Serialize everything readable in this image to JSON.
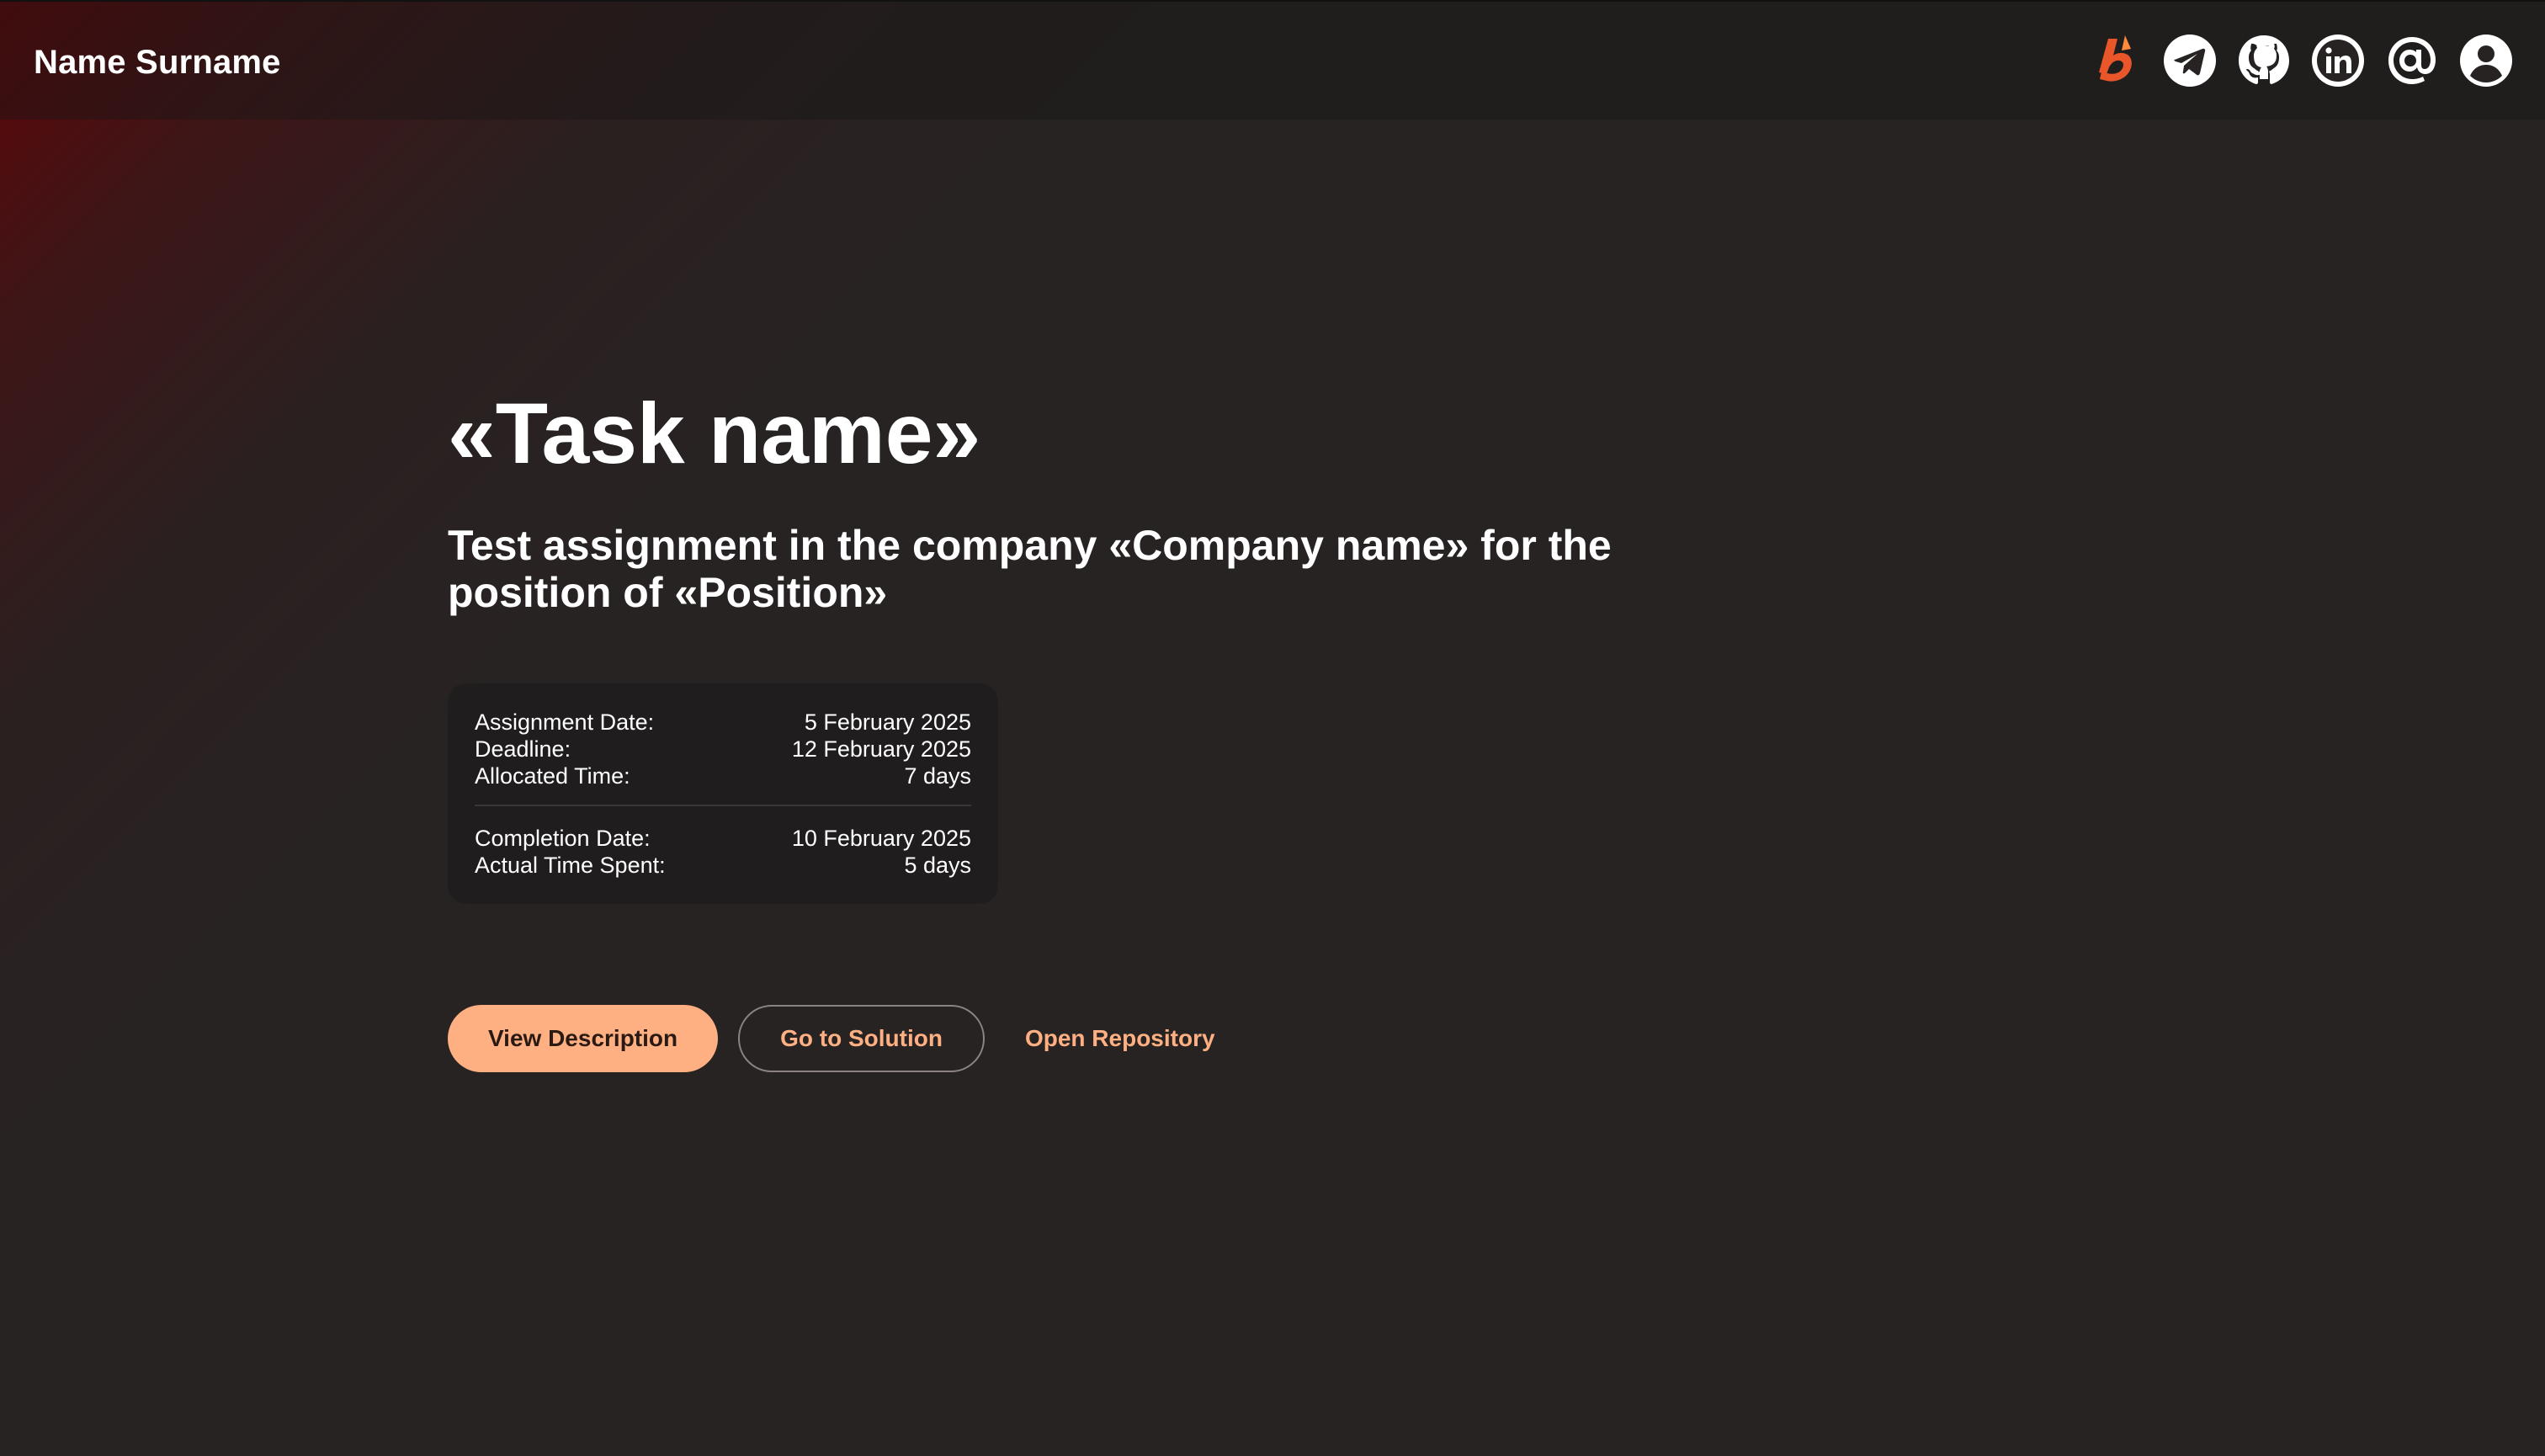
{
  "header": {
    "name": "Name Surname",
    "icons": [
      "behance-icon",
      "telegram-icon",
      "github-icon",
      "linkedin-icon",
      "email-icon",
      "profile-icon"
    ],
    "accent_icon_color": "#e8562a"
  },
  "task": {
    "title": "«Task name»",
    "subtitle": "Test assignment in the company «Company name» for the position of «Position»"
  },
  "details": {
    "assignment_date": {
      "label": "Assignment Date:",
      "value": "5 February 2025"
    },
    "deadline": {
      "label": "Deadline:",
      "value": "12 February 2025"
    },
    "allocated_time": {
      "label": "Allocated Time:",
      "value": "7 days"
    },
    "completion_date": {
      "label": "Completion Date:",
      "value": "10 February 2025"
    },
    "actual_time": {
      "label": "Actual Time Spent:",
      "value": "5 days"
    }
  },
  "actions": {
    "view_description": "View Description",
    "go_to_solution": "Go to Solution",
    "open_repository": "Open Repository"
  },
  "colors": {
    "background": "#272323",
    "accent": "#ffb082",
    "glow": "#5f0508"
  }
}
